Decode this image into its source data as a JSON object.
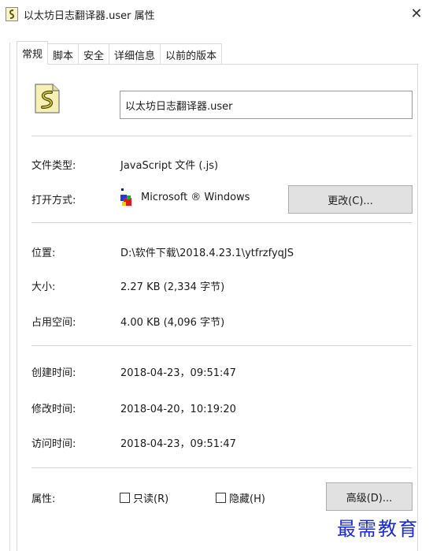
{
  "window": {
    "title": "以太坊日志翻译器.user 属性",
    "close_glyph": "✕"
  },
  "tabs": [
    {
      "label": "常规",
      "active": true
    },
    {
      "label": "脚本",
      "active": false
    },
    {
      "label": "安全",
      "active": false
    },
    {
      "label": "详细信息",
      "active": false
    },
    {
      "label": "以前的版本",
      "active": false
    }
  ],
  "general": {
    "file_name": "以太坊日志翻译器.user",
    "type_label": "文件类型:",
    "type_value": "JavaScript 文件 (.js)",
    "open_with_label": "打开方式:",
    "open_with_value": "Microsoft ® Windows",
    "change_button": "更改(C)...",
    "location_label": "位置:",
    "location_value": "D:\\软件下载\\2018.4.23.1\\ytfrzfyqJS",
    "size_label": "大小:",
    "size_value": "2.27 KB (2,334 字节)",
    "disk_size_label": "占用空间:",
    "disk_size_value": "4.00 KB (4,096 字节)",
    "created_label": "创建时间:",
    "created_value": "2018-04-23，09:51:47",
    "modified_label": "修改时间:",
    "modified_value": "2018-04-20，10:19:20",
    "accessed_label": "访问时间:",
    "accessed_value": "2018-04-23，09:51:47",
    "attributes_label": "属性:",
    "readonly_label": "只读(R)",
    "hidden_label": "隐藏(H)",
    "advanced_button": "高级(D)..."
  },
  "watermark": "最需教育",
  "icons": {
    "title": "script-file-icon",
    "file": "script-file-icon",
    "app": "windows-script-host-icon",
    "close": "close-icon"
  },
  "colors": {
    "watermark": "#1a2bd6",
    "button_bg": "#e1e1e1",
    "border": "#d9d9d9"
  }
}
